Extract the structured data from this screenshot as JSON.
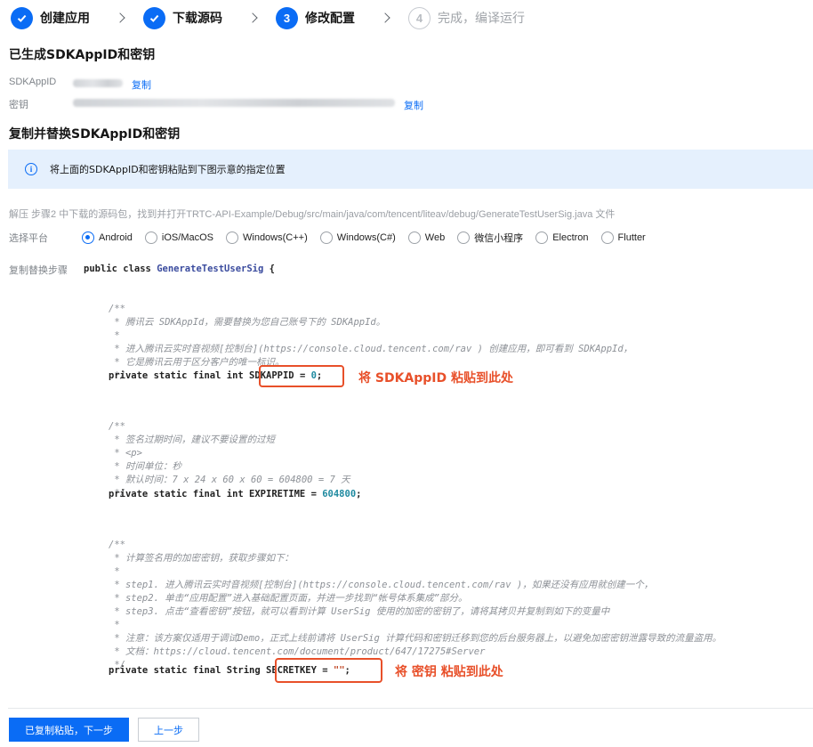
{
  "stepper": {
    "steps": [
      {
        "label": "创建应用",
        "state": "done"
      },
      {
        "label": "下载源码",
        "state": "done"
      },
      {
        "number": "3",
        "label": "修改配置",
        "state": "active"
      },
      {
        "number": "4",
        "label": "完成，编译运行",
        "state": "todo"
      }
    ]
  },
  "generated": {
    "title": "已生成SDKAppID和密钥",
    "appid_label": "SDKAppID",
    "secret_label": "密钥",
    "copy_label": "复制"
  },
  "replace": {
    "title": "复制并替换SDKAppID和密钥",
    "notice_icon": "i",
    "notice": "将上面的SDKAppID和密钥粘贴到下图示意的指定位置",
    "path": "解压 步骤2 中下载的源码包，找到并打开TRTC-API-Example/Debug/src/main/java/com/tencent/liteav/debug/GenerateTestUserSig.java 文件"
  },
  "platform": {
    "label": "选择平台",
    "selected": "Android",
    "options": [
      "Android",
      "iOS/MacOS",
      "Windows(C++)",
      "Windows(C#)",
      "Web",
      "微信小程序",
      "Electron",
      "Flutter"
    ]
  },
  "code": {
    "label": "复制替换步骤",
    "class_prefix": "public class ",
    "class_name": "GenerateTestUserSig",
    "class_suffix": " {",
    "c1": [
      "/**",
      " * 腾讯云 SDKAppId，需要替换为您自己账号下的 SDKAppId。",
      " *",
      " * 进入腾讯云实时音视频[控制台](https://console.cloud.tencent.com/rav ) 创建应用，即可看到 SDKAppId，",
      " * 它是腾讯云用于区分客户的唯一标识。",
      " */"
    ],
    "appid_prefix": "private static final int ",
    "appid_decl": "SDKAPPID = ",
    "appid_value": "0",
    "appid_end": ";",
    "appid_note": "将 SDKAppID 粘贴到此处",
    "c2": [
      "/**",
      " * 签名过期时间，建议不要设置的过短",
      " * <p>",
      " * 时间单位：秒",
      " * 默认时间：7 x 24 x 60 x 60 = 604800 = 7 天",
      " */"
    ],
    "expire_prefix": "private static final int EXPIRETIME = ",
    "expire_value": "604800",
    "expire_end": ";",
    "c3": [
      "/**",
      " * 计算签名用的加密密钥，获取步骤如下：",
      " *",
      " * step1. 进入腾讯云实时音视频[控制台](https://console.cloud.tencent.com/rav )，如果还没有应用就创建一个，",
      " * step2. 单击“应用配置”进入基础配置页面，并进一步找到“帐号体系集成”部分。",
      " * step3. 点击“查看密钥”按钮，就可以看到计算 UserSig 使用的加密的密钥了，请将其拷贝并复制到如下的变量中",
      " *",
      " * 注意：该方案仅适用于调试Demo，正式上线前请将 UserSig 计算代码和密钥迁移到您的后台服务器上，以避免加密密钥泄露导致的流量盗用。",
      " * 文档：https://cloud.tencent.com/document/product/647/17275#Server",
      " */"
    ],
    "secret_prefix": "private static final String ",
    "secret_decl": "SECRETKEY = ",
    "secret_value": "\"\"",
    "secret_end": ";",
    "secret_note": "将 密钥 粘贴到此处"
  },
  "footer": {
    "next_label": "已复制粘贴，下一步",
    "prev_label": "上一步"
  }
}
